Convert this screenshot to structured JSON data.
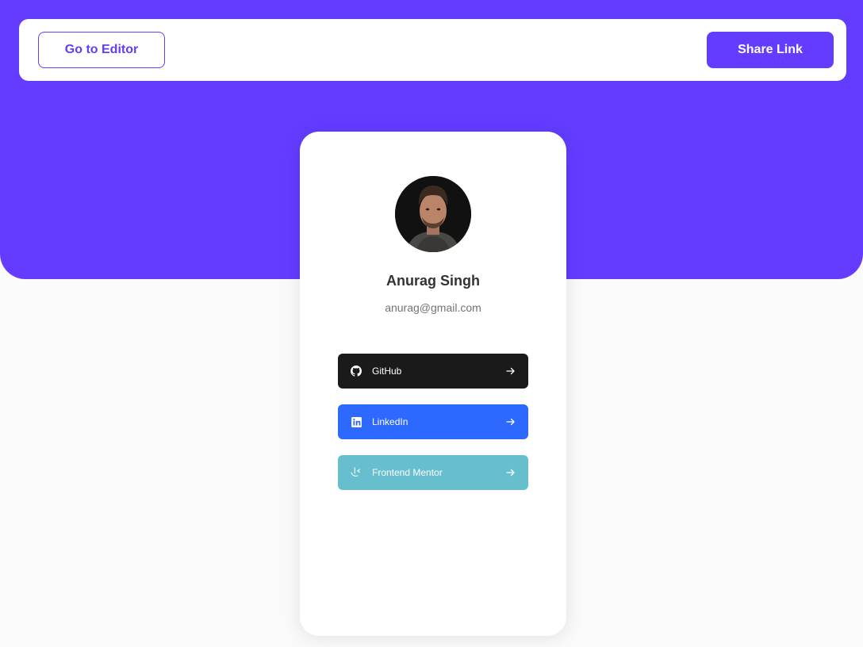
{
  "topbar": {
    "editor_label": "Go to Editor",
    "share_label": "Share Link"
  },
  "profile": {
    "name": "Anurag Singh",
    "email": "anurag@gmail.com"
  },
  "links": [
    {
      "platform": "GitHub",
      "color": "#1A1A1A",
      "icon": "github-icon"
    },
    {
      "platform": "LinkedIn",
      "color": "#2D68FF",
      "icon": "linkedin-icon"
    },
    {
      "platform": "Frontend Mentor",
      "color": "#67BECE",
      "icon": "frontend-mentor-icon"
    }
  ],
  "colors": {
    "brand": "#633CFF",
    "background": "#FAFAFA"
  }
}
